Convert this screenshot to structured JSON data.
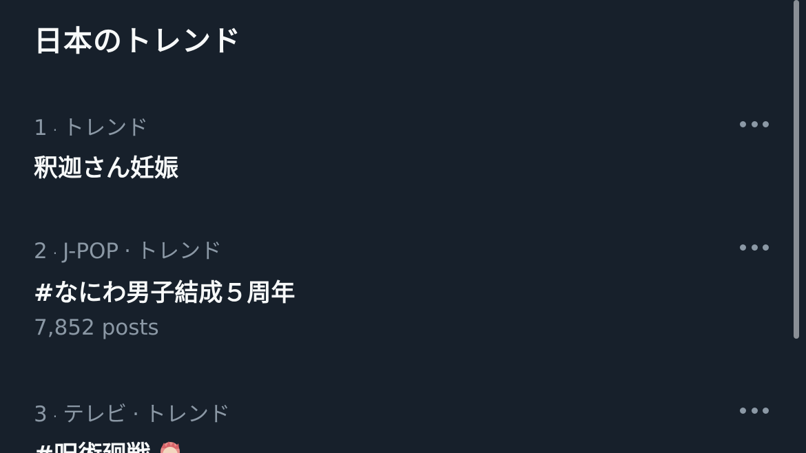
{
  "section": {
    "title": "日本のトレンド"
  },
  "trends": [
    {
      "rank": "1",
      "context": "トレンド",
      "name": "釈迦さん妊娠"
    },
    {
      "rank": "2",
      "category": "J-POP",
      "context": "トレンド",
      "name": "#なにわ男子結成５周年",
      "posts": "7,852 posts"
    },
    {
      "rank": "3",
      "category": "テレビ",
      "context": "トレンド",
      "name": "#呪術廻戦",
      "emoji": "character-face-emoji"
    }
  ],
  "colors": {
    "background": "#17202b",
    "primary_text": "#f7f9f9",
    "secondary_text": "#8b98a5",
    "scrollbar": "#8a8f96"
  },
  "icons": {
    "more": "more-horizontal-icon"
  }
}
